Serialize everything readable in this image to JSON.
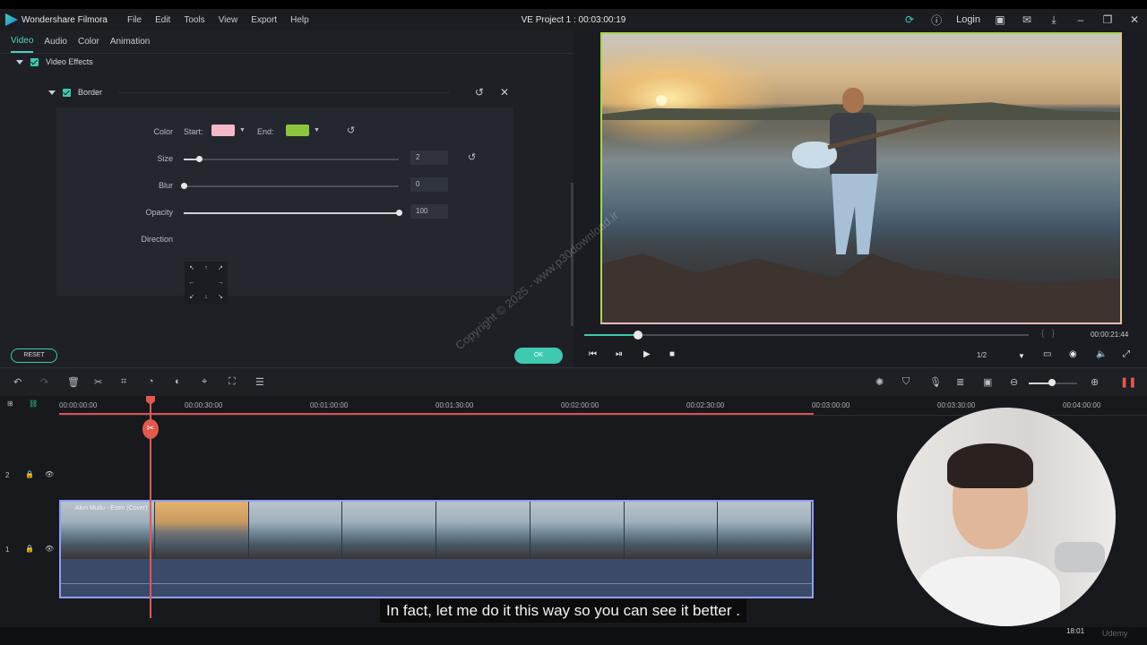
{
  "app": {
    "name": "Wondershare Filmora",
    "project": "VE Project 1 : 00:03:00:19",
    "login": "Login"
  },
  "menu": [
    "File",
    "Edit",
    "Tools",
    "View",
    "Export",
    "Help"
  ],
  "tabs": [
    "Video",
    "Audio",
    "Color",
    "Animation"
  ],
  "effects": {
    "section": "Video Effects",
    "border": {
      "title": "Border",
      "color_label": "Color",
      "start_label": "Start:",
      "end_label": "End:",
      "start_color": "#f5b8c6",
      "end_color": "#8dc53e",
      "size_label": "Size",
      "size_value": "2",
      "size_fraction": 0.07,
      "blur_label": "Blur",
      "blur_value": "0",
      "blur_fraction": 0.0,
      "opacity_label": "Opacity",
      "opacity_value": "100",
      "opacity_fraction": 1.0,
      "direction_label": "Direction",
      "directions": [
        "↖",
        "↑",
        "↗",
        "←",
        "",
        "→",
        "↙",
        "↓",
        "↘"
      ]
    },
    "reset": "RESET",
    "ok": "OK"
  },
  "preview": {
    "time": "00:00:21:44",
    "ratio": "1/2",
    "playback_fraction": 0.12
  },
  "timeline": {
    "ticks": [
      "00:00:00:00",
      "00:00:30:00",
      "00:01:00:00",
      "00:01:30:00",
      "00:02:00:00",
      "00:02:30:00",
      "00:03:00:00",
      "00:03:30:00",
      "00:04:00:00"
    ],
    "track2_label": "2",
    "track1_label": "1",
    "clip_title": "Akın Mutlu - Esen (Cover)"
  },
  "subtitle": "In fact, let me do it this way so you can see it better .",
  "watermark": "Copyright © 2025 - www.p30download.ir",
  "clock": "18:01",
  "brand": "Udemy",
  "colors": {
    "accent": "#3fc9b0",
    "playhead": "#e05a4f",
    "clip_border": "#8f9ef2"
  }
}
